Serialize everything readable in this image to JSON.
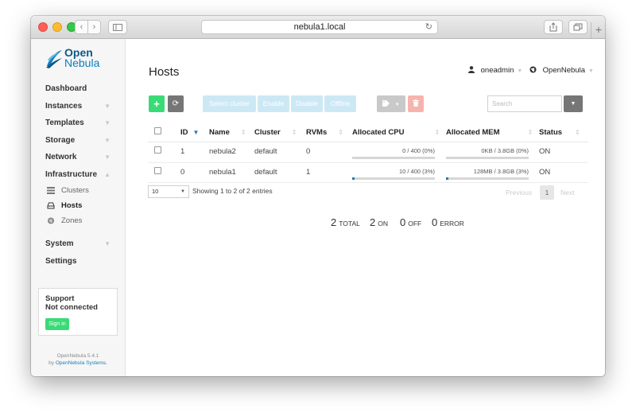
{
  "browser": {
    "url": "nebula1.local",
    "back_glyph": "‹",
    "fwd_glyph": "›",
    "plus": "+"
  },
  "logo": {
    "line1": "Open",
    "line2": "Nebula"
  },
  "sidebar": {
    "items": [
      {
        "label": "Dashboard",
        "caret": ""
      },
      {
        "label": "Instances",
        "caret": "▼"
      },
      {
        "label": "Templates",
        "caret": "▼"
      },
      {
        "label": "Storage",
        "caret": "▼"
      },
      {
        "label": "Network",
        "caret": "▼"
      },
      {
        "label": "Infrastructure",
        "caret": "▲"
      }
    ],
    "subitems": [
      {
        "label": "Clusters",
        "icon": "server-icon"
      },
      {
        "label": "Hosts",
        "icon": "hdd-icon"
      },
      {
        "label": "Zones",
        "icon": "globe-icon"
      }
    ],
    "bottom_items": [
      {
        "label": "System",
        "caret": "▼"
      },
      {
        "label": "Settings",
        "caret": ""
      }
    ],
    "support": {
      "title": "Support",
      "status": "Not connected",
      "signin": "Sign in"
    },
    "version": "OpenNebula 5.4.1",
    "by_prefix": "by",
    "by_company": "OpenNebula Systems."
  },
  "header": {
    "title": "Hosts",
    "user": "oneadmin",
    "zone": "OpenNebula"
  },
  "toolbar": {
    "create": "+",
    "refresh": "⟳",
    "select_cluster": "Select cluster",
    "enable": "Enable",
    "disable": "Disable",
    "offline": "Offline",
    "search_placeholder": "Search"
  },
  "table": {
    "columns": [
      "ID",
      "Name",
      "Cluster",
      "RVMs",
      "Allocated CPU",
      "Allocated MEM",
      "Status"
    ],
    "rows": [
      {
        "id": "1",
        "name": "nebula2",
        "cluster": "default",
        "rvms": "0",
        "cpu": "0 / 400 (0%)",
        "cpu_pct": 0,
        "mem": "0KB / 3.8GB (0%)",
        "mem_pct": 0,
        "status": "ON"
      },
      {
        "id": "0",
        "name": "nebula1",
        "cluster": "default",
        "rvms": "1",
        "cpu": "10 / 400 (3%)",
        "cpu_pct": 3,
        "mem": "128MB / 3.8GB (3%)",
        "mem_pct": 3,
        "status": "ON"
      }
    ],
    "page_length": "10",
    "info": "Showing 1 to 2 of 2 entries",
    "prev": "Previous",
    "page": "1",
    "next": "Next"
  },
  "summary": {
    "total": "2",
    "total_label": "TOTAL",
    "on": "2",
    "on_label": "ON",
    "off": "0",
    "off_label": "OFF",
    "error": "0",
    "error_label": "ERROR"
  },
  "colors": {
    "accent": "#1a7cb8",
    "success": "#3adb76",
    "alert": "#f7b4ad"
  }
}
